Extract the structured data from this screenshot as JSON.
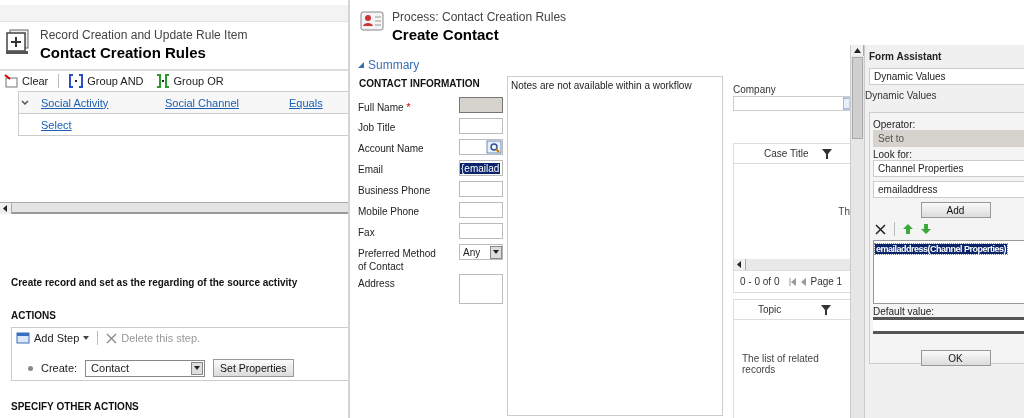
{
  "rule_item": {
    "subtitle": "Record Creation and Update Rule Item",
    "title": "Contact Creation Rules",
    "toolbar": [
      {
        "kind": "clear",
        "label": "Clear"
      },
      {
        "kind": "group_and",
        "label": "Group AND"
      },
      {
        "kind": "group_or",
        "label": "Group OR"
      }
    ],
    "condition": {
      "expanded": true,
      "cells": [
        "Social Activity",
        "Social Channel",
        "Equals"
      ],
      "add_link": "Select"
    },
    "description": "Create record and set as the regarding of the source activity",
    "actions_heading": "ACTIONS",
    "actions_toolbar": {
      "add_step": "Add Step",
      "delete_step": "Delete this step.",
      "delete_disabled": true
    },
    "step": {
      "label": "Create:",
      "entity": "Contact",
      "button": "Set Properties"
    },
    "other_actions_heading": "SPECIFY OTHER ACTIONS"
  },
  "process_form": {
    "subtitle": "Process: Contact Creation Rules",
    "title": "Create Contact",
    "section": "Summary",
    "section_expanded": true,
    "group_heading": "CONTACT INFORMATION",
    "fields": [
      {
        "label": "Full Name",
        "kind": "text",
        "required_mark": "*",
        "disabled": true
      },
      {
        "label": "Job Title",
        "kind": "text",
        "disabled": false
      },
      {
        "label": "Account Name",
        "kind": "lookup",
        "disabled": false
      },
      {
        "label": "Email",
        "kind": "text",
        "value": "{emailad",
        "highlighted": true,
        "disabled": false
      },
      {
        "label": "Business Phone",
        "kind": "text",
        "disabled": false
      },
      {
        "label": "Mobile Phone",
        "kind": "text",
        "disabled": false
      },
      {
        "label": "Fax",
        "kind": "text",
        "disabled": false
      },
      {
        "label": "Preferred Method of Contact",
        "kind": "select",
        "value": "Any",
        "disabled": false
      },
      {
        "label": "Address",
        "kind": "textarea",
        "disabled": false
      }
    ],
    "notes": "Notes are not available within a workflow",
    "company_label": "Company",
    "cases_grid": {
      "column": "Case Title",
      "message": "Th",
      "count": "0 - 0 of 0",
      "page": "Page 1"
    },
    "topics_grid": {
      "column": "Topic",
      "message": "The list of related records"
    }
  },
  "form_assistant": {
    "title": "Form Assistant",
    "mode": "Dynamic Values",
    "mode_caption": "Dynamic Values",
    "operator_label": "Operator:",
    "operator": "Set to",
    "look_for_label": "Look for:",
    "look_for": "Channel Properties",
    "attribute": "emailaddress",
    "add_button": "Add",
    "items": [
      {
        "text": "emailaddress(Channel Properties)",
        "selected": true
      }
    ],
    "default_label": "Default value:",
    "ok_button": "OK"
  }
}
